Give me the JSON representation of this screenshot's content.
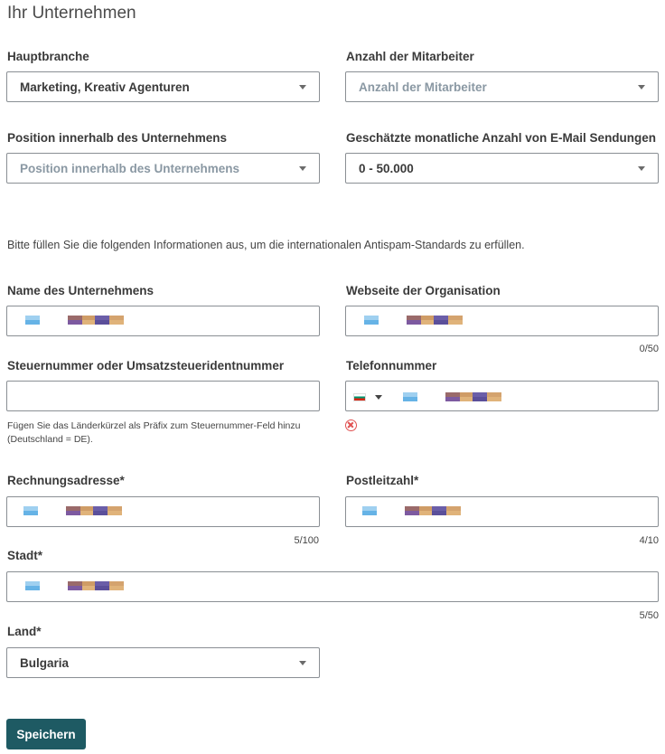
{
  "heading": "Ihr Unternehmen",
  "hauptbranche": {
    "label": "Hauptbranche",
    "value": "Marketing, Kreativ Agenturen"
  },
  "mitarbeiter": {
    "label": "Anzahl der Mitarbeiter",
    "placeholder": "Anzahl der Mitarbeiter"
  },
  "position": {
    "label": "Position innerhalb des Unternehmens",
    "placeholder": "Position innerhalb des Unternehmens"
  },
  "email_volume": {
    "label": "Geschätzte monatliche Anzahl von E-Mail Sendungen",
    "value": "0 - 50.000"
  },
  "info_text": "Bitte füllen Sie die folgenden Informationen aus, um die internationalen Antispam-Standards zu erfüllen.",
  "company_name": {
    "label": "Name des Unternehmens"
  },
  "website": {
    "label": "Webseite der Organisation",
    "counter": "0/50"
  },
  "tax_number": {
    "label": "Steuernummer oder Umsatzsteueridentnummer",
    "hint": "Fügen Sie das Länderkürzel als Präfix zum Steuernummer-Feld hinzu (Deutschland = DE)."
  },
  "phone": {
    "label": "Telefonnummer",
    "country_flag": "bulgaria-flag"
  },
  "billing_address": {
    "label": "Rechnungsadresse*",
    "counter": "5/100"
  },
  "postal_code": {
    "label": "Postleitzahl*",
    "counter": "4/10"
  },
  "city": {
    "label": "Stadt*",
    "counter": "5/50"
  },
  "country": {
    "label": "Land*",
    "value": "Bulgaria"
  },
  "save_button": "Speichern",
  "colors": {
    "primary_button": "#1e5a63",
    "error": "#e05050",
    "border": "#8a8f94"
  }
}
